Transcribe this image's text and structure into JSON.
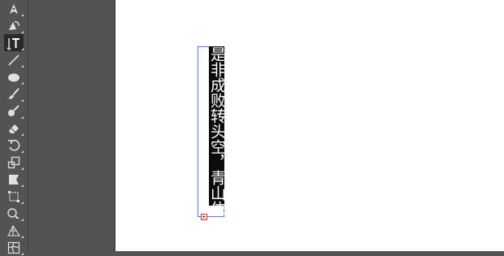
{
  "toolbar": {
    "tools": [
      {
        "name": "pen-tool",
        "icon": "pen-icon"
      },
      {
        "name": "curvature-tool",
        "icon": "curvature-pen-icon"
      },
      {
        "name": "vertical-type-tool",
        "icon": "vertical-type-icon",
        "selected": true
      },
      {
        "name": "line-segment-tool",
        "icon": "line-icon"
      },
      {
        "name": "ellipse-tool",
        "icon": "ellipse-icon"
      },
      {
        "name": "paintbrush-tool",
        "icon": "paintbrush-icon"
      },
      {
        "name": "shaper-tool",
        "icon": "shaper-icon"
      },
      {
        "name": "eraser-tool",
        "icon": "eraser-icon"
      },
      {
        "name": "rotate-tool",
        "icon": "rotate-icon"
      },
      {
        "name": "scale-tool",
        "icon": "scale-icon"
      },
      {
        "name": "width-tool",
        "icon": "width-icon"
      },
      {
        "name": "free-transform-tool",
        "icon": "free-transform-icon"
      },
      {
        "name": "shape-builder-tool",
        "icon": "shape-builder-icon"
      },
      {
        "name": "perspective-grid-tool",
        "icon": "perspective-grid-icon"
      },
      {
        "name": "mesh-tool",
        "icon": "mesh-icon"
      }
    ]
  },
  "canvas": {
    "vertical_text": "是非成败转头空，青山依",
    "colors": {
      "selection_frame": "#4f7fe6",
      "text_highlight": "#0c0c0c",
      "overflow_port": "#e0322e",
      "panel_bg": "#535353"
    }
  }
}
